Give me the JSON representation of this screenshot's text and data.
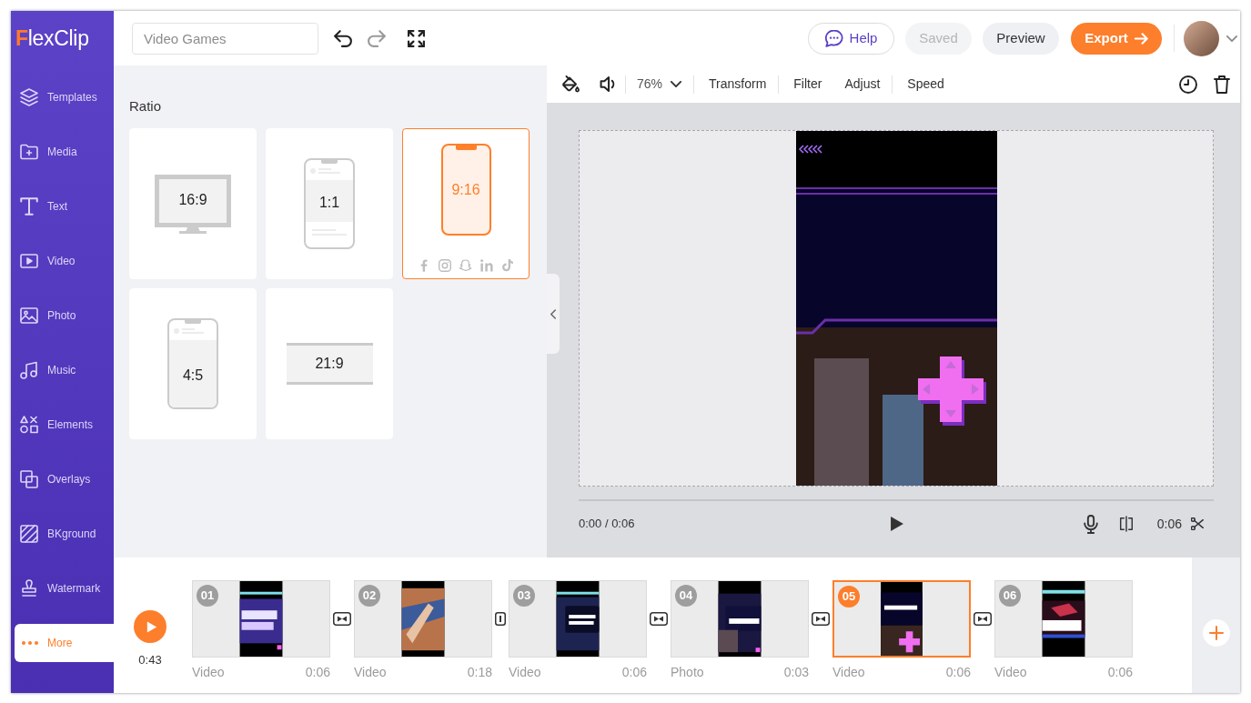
{
  "sidebar": {
    "logo": "FlexClip",
    "items": [
      {
        "label": "Templates",
        "selected": false
      },
      {
        "label": "Media",
        "selected": false
      },
      {
        "label": "Text",
        "selected": false
      },
      {
        "label": "Video",
        "selected": false
      },
      {
        "label": "Photo",
        "selected": false
      },
      {
        "label": "Music",
        "selected": false
      },
      {
        "label": "Elements",
        "selected": false
      },
      {
        "label": "Overlays",
        "selected": false
      },
      {
        "label": "BKground",
        "selected": false
      },
      {
        "label": "Watermark",
        "selected": false
      },
      {
        "label": "More",
        "selected": true
      }
    ]
  },
  "top_bar": {
    "project_title": "Video Games",
    "history": [
      {
        "kind": "undo",
        "disabled": false
      },
      {
        "kind": "redo",
        "disabled": true
      }
    ],
    "buttons": [
      {
        "kind": "help",
        "label": "Help",
        "disabled": false
      },
      {
        "kind": "saved",
        "label": "Saved",
        "disabled": true
      },
      {
        "kind": "preview",
        "label": "Preview",
        "disabled": false
      },
      {
        "kind": "export",
        "label": "Export",
        "disabled": false
      }
    ]
  },
  "ratio_panel": {
    "title": "Ratio",
    "options": [
      {
        "kind": "monitor",
        "label": "16:9",
        "selected": false
      },
      {
        "kind": "phone_square",
        "label": "1:1",
        "selected": false
      },
      {
        "kind": "phone_full",
        "label": "9:16",
        "selected": true
      },
      {
        "kind": "phone_portrait",
        "label": "4:5",
        "selected": false
      },
      {
        "kind": "cinema",
        "label": "21:9",
        "selected": false
      }
    ]
  },
  "preview_toolbar": {
    "zoom": "76%",
    "tool_groups": [
      [
        "Transform"
      ],
      [
        "Filter",
        "Adjust"
      ],
      [
        "Speed"
      ]
    ]
  },
  "player": {
    "progress": {
      "level": 0
    },
    "time": "0:00 / 0:06",
    "clip_duration": "0:06"
  },
  "timeline": {
    "total_duration": "0:43",
    "clips": [
      {
        "number": "01",
        "type": "Video",
        "duration": "0:06",
        "selected": false
      },
      {
        "number": "02",
        "type": "Video",
        "duration": "0:18",
        "selected": false
      },
      {
        "number": "03",
        "type": "Video",
        "duration": "0:06",
        "selected": false
      },
      {
        "number": "04",
        "type": "Photo",
        "duration": "0:03",
        "selected": false
      },
      {
        "number": "05",
        "type": "Video",
        "duration": "0:06",
        "selected": true
      },
      {
        "number": "06",
        "type": "Video",
        "duration": "0:06",
        "selected": false
      }
    ],
    "transitions": [
      {
        "kind": "transition"
      },
      {
        "kind": "cut"
      },
      {
        "kind": "transition"
      },
      {
        "kind": "transition"
      },
      {
        "kind": "transition"
      }
    ]
  }
}
